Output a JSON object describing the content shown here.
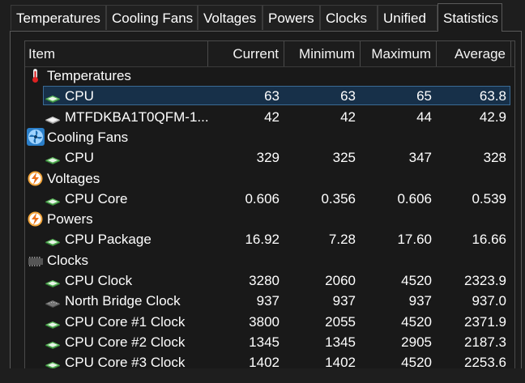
{
  "tabs": [
    {
      "label": "Temperatures",
      "active": false
    },
    {
      "label": "Cooling Fans",
      "active": false
    },
    {
      "label": "Voltages",
      "active": false
    },
    {
      "label": "Powers",
      "active": false
    },
    {
      "label": "Clocks",
      "active": false
    },
    {
      "label": "Unified",
      "active": false
    },
    {
      "label": "Statistics",
      "active": true
    }
  ],
  "columns": [
    "Item",
    "Current",
    "Minimum",
    "Maximum",
    "Average"
  ],
  "rows": [
    {
      "type": "group",
      "icon": "thermometer-icon",
      "label": "Temperatures"
    },
    {
      "type": "item",
      "icon": "chip-icon",
      "label": "CPU",
      "current": "63",
      "minimum": "63",
      "maximum": "65",
      "average": "63.8",
      "selected": true
    },
    {
      "type": "item",
      "icon": "drive-icon",
      "label": "MTFDKBA1T0QFM-1...",
      "current": "42",
      "minimum": "42",
      "maximum": "44",
      "average": "42.9"
    },
    {
      "type": "group",
      "icon": "fan-icon",
      "label": "Cooling Fans"
    },
    {
      "type": "item",
      "icon": "chip-icon",
      "label": "CPU",
      "current": "329",
      "minimum": "325",
      "maximum": "347",
      "average": "328"
    },
    {
      "type": "group",
      "icon": "lightning-icon",
      "label": "Voltages"
    },
    {
      "type": "item",
      "icon": "chip-icon",
      "label": "CPU Core",
      "current": "0.606",
      "minimum": "0.356",
      "maximum": "0.606",
      "average": "0.539"
    },
    {
      "type": "group",
      "icon": "lightning-icon",
      "label": "Powers"
    },
    {
      "type": "item",
      "icon": "chip-icon",
      "label": "CPU Package",
      "current": "16.92",
      "minimum": "7.28",
      "maximum": "17.60",
      "average": "16.66"
    },
    {
      "type": "group",
      "icon": "clock-chip-icon",
      "label": "Clocks"
    },
    {
      "type": "item",
      "icon": "chip-icon",
      "label": "CPU Clock",
      "current": "3280",
      "minimum": "2060",
      "maximum": "4520",
      "average": "2323.9"
    },
    {
      "type": "item",
      "icon": "dark-chip-icon",
      "label": "North Bridge Clock",
      "current": "937",
      "minimum": "937",
      "maximum": "937",
      "average": "937.0"
    },
    {
      "type": "item",
      "icon": "chip-icon",
      "label": "CPU Core #1 Clock",
      "current": "3800",
      "minimum": "2055",
      "maximum": "4520",
      "average": "2371.9"
    },
    {
      "type": "item",
      "icon": "chip-icon",
      "label": "CPU Core #2 Clock",
      "current": "1345",
      "minimum": "1345",
      "maximum": "2905",
      "average": "2187.3"
    },
    {
      "type": "item",
      "icon": "chip-icon",
      "label": "CPU Core #3 Clock",
      "current": "1402",
      "minimum": "1402",
      "maximum": "4520",
      "average": "2253.6"
    }
  ]
}
